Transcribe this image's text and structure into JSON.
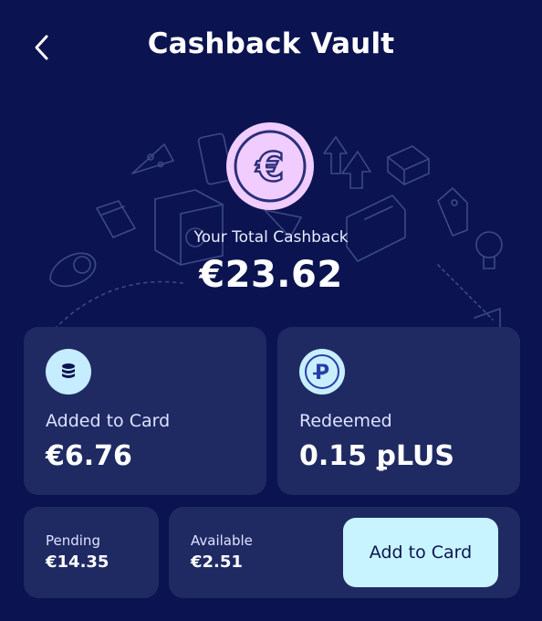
{
  "header": {
    "title": "Cashback Vault"
  },
  "summary": {
    "total_label": "Your Total Cashback",
    "total_amount": "€23.62",
    "currency_symbol": "€"
  },
  "cards": {
    "added": {
      "label": "Added to Card",
      "value": "€6.76"
    },
    "redeemed": {
      "label": "Redeemed",
      "value": "0.15 ꝑLUS",
      "icon_letter": "P"
    },
    "pending": {
      "label": "Pending",
      "value": "€14.35"
    },
    "available": {
      "label": "Available",
      "value": "€2.51",
      "button_label": "Add to Card"
    }
  },
  "colors": {
    "background": "#0b1450",
    "card": "#1f2a63",
    "accent": "#c8f4ff",
    "coin": "#f1ccff"
  }
}
